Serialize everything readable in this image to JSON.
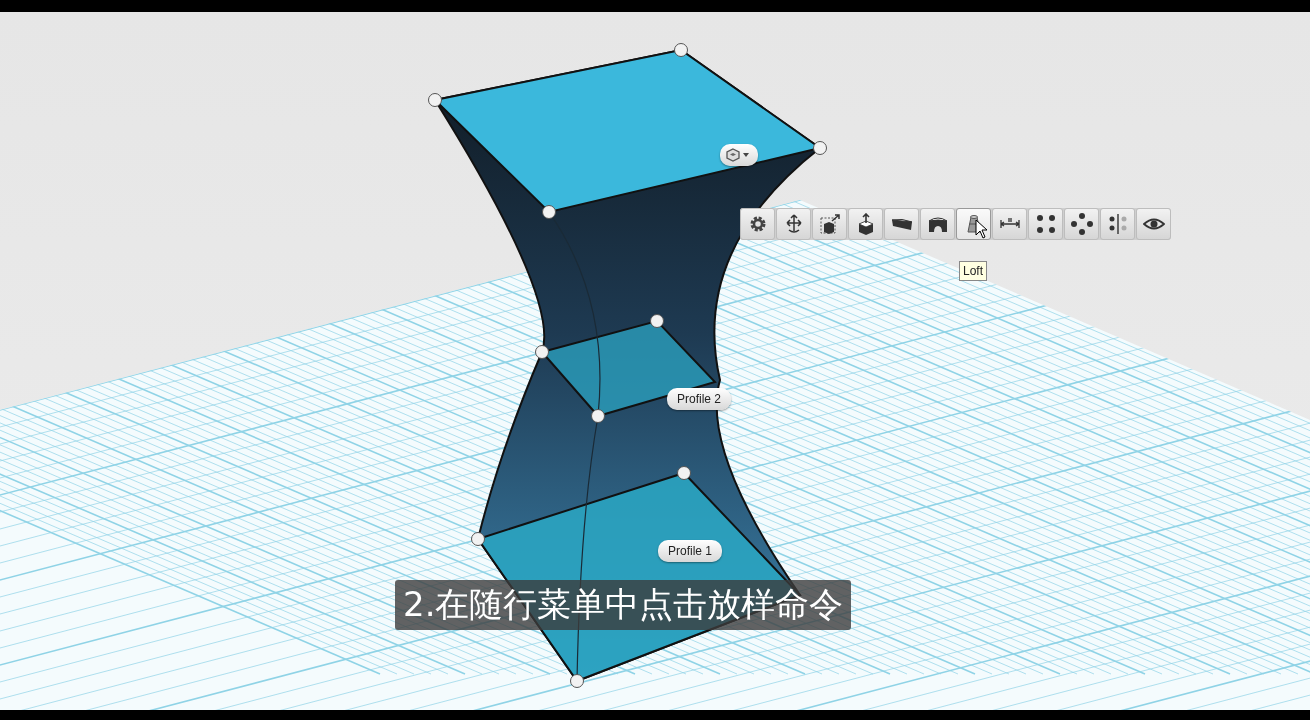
{
  "viewport": {
    "toolbar": [
      {
        "kind": "settings",
        "hovered": false
      },
      {
        "kind": "move",
        "hovered": false
      },
      {
        "kind": "scale",
        "hovered": false
      },
      {
        "kind": "extrude",
        "hovered": false
      },
      {
        "kind": "block",
        "hovered": false
      },
      {
        "kind": "arch",
        "hovered": false
      },
      {
        "kind": "loft",
        "hovered": true
      },
      {
        "kind": "dimension",
        "hovered": false
      },
      {
        "kind": "grid-dots",
        "hovered": false
      },
      {
        "kind": "ring-dots",
        "hovered": false
      },
      {
        "kind": "mirror-dots",
        "hovered": false
      },
      {
        "kind": "eye",
        "hovered": false
      }
    ],
    "tooltip": "Loft",
    "profile_labels": [
      "Profile 2",
      "Profile 1"
    ]
  },
  "subtitle": "2.在随行菜单中点击放样命令"
}
